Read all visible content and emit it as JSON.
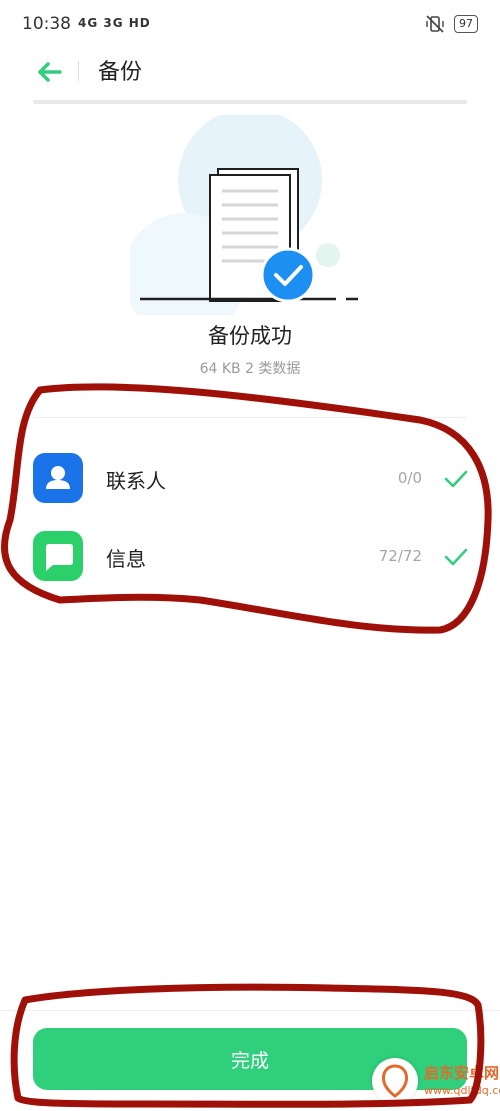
{
  "status": {
    "time": "10:38",
    "network": "4G 3G HD",
    "battery": "97"
  },
  "header": {
    "title": "备份"
  },
  "result": {
    "title": "备份成功",
    "summary": "64 KB  2 类数据"
  },
  "items": [
    {
      "label": "联系人",
      "count": "0/0",
      "icon": "contacts-icon",
      "color": "#1a73e8"
    },
    {
      "label": "信息",
      "count": "72/72",
      "icon": "message-icon",
      "color": "#2bd06a"
    }
  ],
  "footer": {
    "done_label": "完成"
  },
  "watermark": {
    "name": "启东安卓网",
    "url": "www.qdltdq.com"
  },
  "colors": {
    "accent": "#2fcf7b",
    "check": "#2fcf7b",
    "success_badge": "#1d8ff2"
  }
}
